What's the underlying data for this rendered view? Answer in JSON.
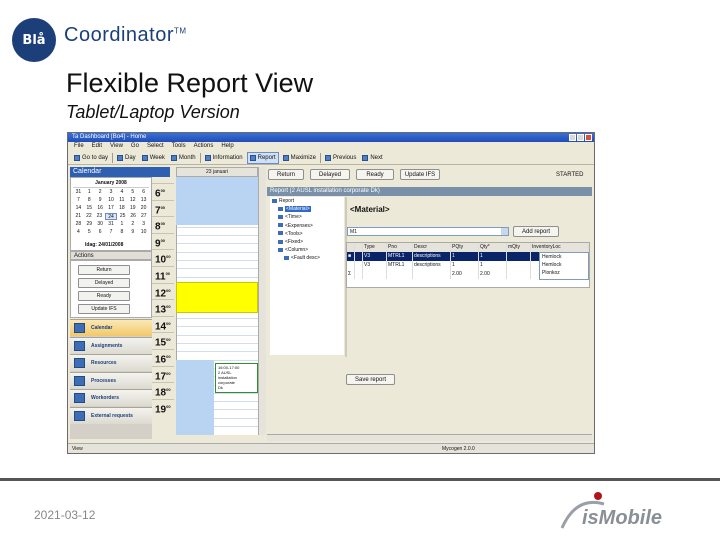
{
  "slide": {
    "logo_mark": "Blå",
    "logo_word": "Coordinator",
    "logo_tm": "TM",
    "title": "Flexible Report View",
    "subtitle": "Tablet/Laptop Version",
    "date": "2021-03-12",
    "footer_logo_text": "isMobile"
  },
  "app": {
    "title": "Ta Dashboard [Bo4] - Home",
    "menu": [
      "File",
      "Edit",
      "View",
      "Go",
      "Select",
      "Tools",
      "Actions",
      "Help"
    ],
    "toolbar": [
      "Go to day",
      "Day",
      "Week",
      "Month",
      "Information",
      "Report",
      "Maximize",
      "Previous",
      "Next"
    ],
    "calendar_header": "Calendar",
    "minical": {
      "month": "January 2008",
      "rows": [
        [
          "31",
          "1",
          "2",
          "3",
          "4",
          "5",
          "6"
        ],
        [
          "7",
          "8",
          "9",
          "10",
          "11",
          "12",
          "13"
        ],
        [
          "14",
          "15",
          "16",
          "17",
          "18",
          "19",
          "20"
        ],
        [
          "21",
          "22",
          "23",
          "24",
          "25",
          "26",
          "27"
        ],
        [
          "28",
          "29",
          "30",
          "31",
          "1",
          "2",
          "3"
        ],
        [
          "4",
          "5",
          "6",
          "7",
          "8",
          "9",
          "10"
        ]
      ],
      "today_label": "Idag: 24/01/2008"
    },
    "actions_header": "Actions",
    "action_buttons": [
      "Return",
      "Delayed",
      "Ready",
      "Update IFS"
    ],
    "nav": [
      {
        "label": "Calendar",
        "active": true
      },
      {
        "label": "Assignments",
        "active": false
      },
      {
        "label": "Resources",
        "active": false
      },
      {
        "label": "Processes",
        "active": false
      },
      {
        "label": "Workorders",
        "active": false
      },
      {
        "label": "External requests",
        "active": false
      }
    ],
    "day_header": "23 januari",
    "hours": [
      {
        "h": "6",
        "m": "00"
      },
      {
        "h": "7",
        "m": "00"
      },
      {
        "h": "8",
        "m": "00"
      },
      {
        "h": "9",
        "m": "00"
      },
      {
        "h": "10",
        "m": "00"
      },
      {
        "h": "11",
        "m": "00"
      },
      {
        "h": "12",
        "m": "00"
      },
      {
        "h": "13",
        "m": "00"
      },
      {
        "h": "14",
        "m": "00"
      },
      {
        "h": "15",
        "m": "00"
      },
      {
        "h": "16",
        "m": "00"
      },
      {
        "h": "17",
        "m": "00"
      },
      {
        "h": "18",
        "m": "00"
      },
      {
        "h": "19",
        "m": "00"
      }
    ],
    "appointment": [
      "16:00-17:00",
      "2 AUSL",
      "installation",
      "corporate",
      "Dk"
    ],
    "status_buttons": [
      "Return",
      "Delayed",
      "Ready",
      "Update IFS"
    ],
    "status": "STARTED",
    "report_header": "Report (2 AUSL installation corporate Dk)",
    "tree": [
      {
        "label": "Report",
        "indent": 0,
        "selected": false
      },
      {
        "label": "<Material>",
        "indent": 1,
        "selected": true
      },
      {
        "label": "<Time>",
        "indent": 1,
        "selected": false
      },
      {
        "label": "<Expenses>",
        "indent": 1,
        "selected": false
      },
      {
        "label": "<Tools>",
        "indent": 1,
        "selected": false
      },
      {
        "label": "<Fixed>",
        "indent": 1,
        "selected": false
      },
      {
        "label": "<Column>",
        "indent": 1,
        "selected": false
      },
      {
        "label": "<Fault desc>",
        "indent": 2,
        "selected": false
      }
    ],
    "material_title": "<Material>",
    "material_input": "M1",
    "add_report_label": "Add report",
    "grid": {
      "headers": [
        "",
        "",
        "Type",
        "Pno",
        "Descr",
        "PQty",
        "Qty*",
        "mQty",
        "InventoryLoc"
      ],
      "rows": [
        [
          "■",
          "",
          "V3",
          "MTRL1",
          "descriptions",
          "1",
          "1",
          "",
          ""
        ],
        [
          "",
          "",
          "V3",
          "MTRL1",
          "descriptions",
          "1",
          "1",
          "",
          ""
        ],
        [
          "Σ",
          "",
          "",
          "",
          "",
          "2.00",
          "2.00",
          "",
          ""
        ]
      ]
    },
    "inventory_options": [
      "Hemlock",
      "Hemlock",
      "Plonkoz"
    ],
    "save_report_label": "Save report",
    "statusbar_left": "View",
    "statusbar_right": "Mycogen 2.0.0"
  }
}
